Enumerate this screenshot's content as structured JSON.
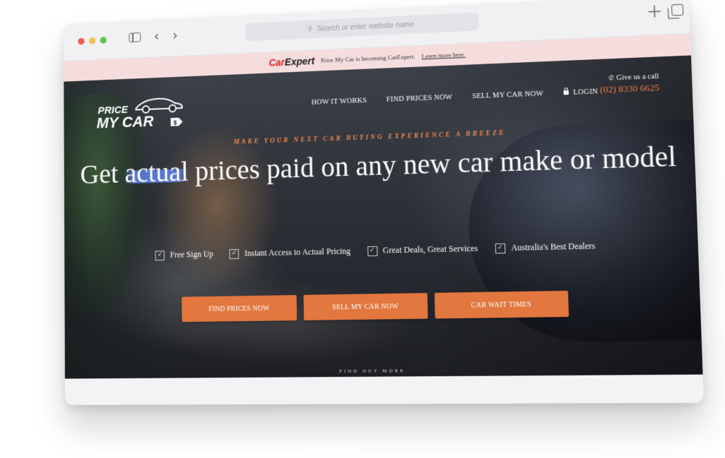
{
  "browser": {
    "address_placeholder": "Search or enter website name",
    "icons": [
      "sidebar-icon",
      "chevron-left-icon",
      "chevron-right-icon",
      "search-icon",
      "plus-icon",
      "tabs-icon"
    ]
  },
  "announcement": {
    "brand_part1": "Car",
    "brand_part2": "Expert",
    "text": "Price My Car is becoming CarExpert.",
    "link_text": "Learn more here.",
    "background": "#f6dddd"
  },
  "site": {
    "logo_line1": "PRICE",
    "logo_line2": "MY CAR",
    "nav": {
      "how_it_works": "HOW IT WORKS",
      "find_prices": "FIND PRICES NOW",
      "sell_my_car": "SELL MY CAR NOW",
      "login": "LOGIN"
    },
    "call": {
      "label": "Give us a call",
      "number": "(02) 8330 6625"
    }
  },
  "hero": {
    "tagline": "MAKE YOUR NEXT CAR BUYING EXPERIENCE A BREEZE",
    "headline_pre": "Get ",
    "headline_highlight": "actual",
    "headline_post": " prices paid on any new car make or model",
    "features": [
      {
        "label": "Free Sign Up"
      },
      {
        "label": "Instant Access to Actual Pricing"
      },
      {
        "label": "Great Deals, Great Services"
      },
      {
        "label": "Australia's Best Dealers"
      }
    ],
    "buttons": {
      "find_prices": "FIND PRICES NOW",
      "sell_my_car": "SELL MY CAR NOW",
      "wait_times": "CAR WAIT TIMES"
    },
    "find_out_more": "FIND OUT MORE",
    "accent_color": "#e2773f"
  }
}
